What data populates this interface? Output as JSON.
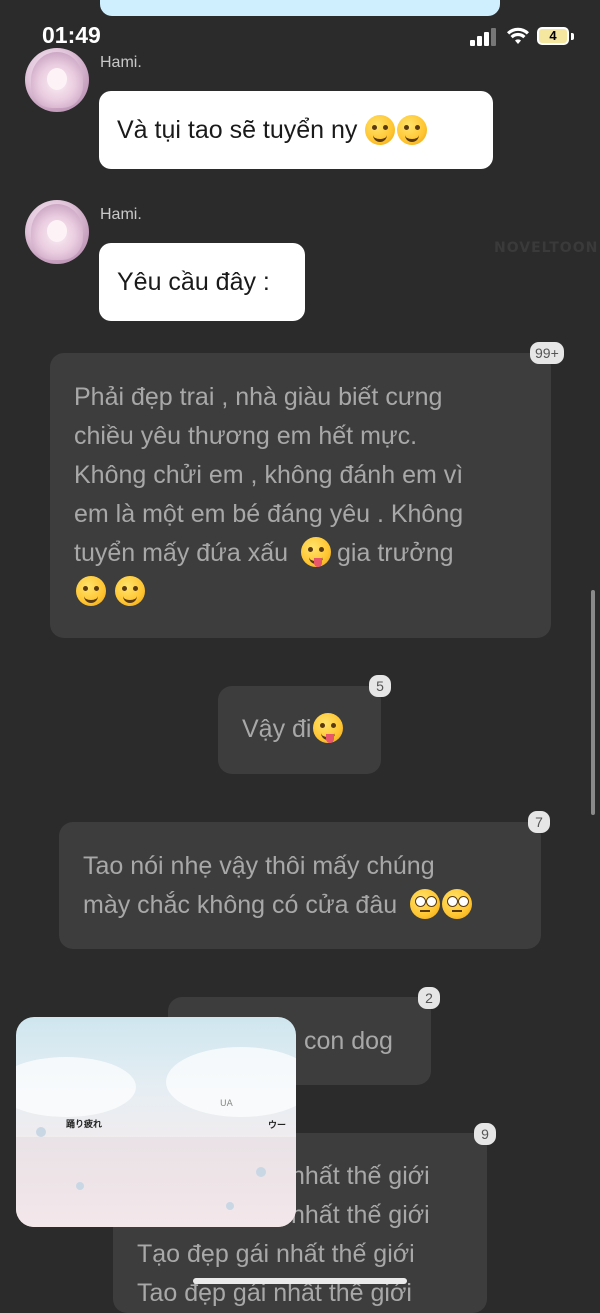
{
  "status": {
    "time": "01:49",
    "battery": "4"
  },
  "messages": [
    {
      "sender": "Hami.",
      "text": "Và tụi tao sẽ tuyển ny",
      "emoji": [
        "rolling-on-floor-laughing-icon",
        "rolling-on-floor-laughing-icon"
      ]
    },
    {
      "sender": "Hami.",
      "text": "Yêu cầu đây :"
    }
  ],
  "cards": [
    {
      "lines": [
        "Phải đẹp trai , nhà giàu biết cưng",
        "chiều yêu thương em hết mực.",
        "Không chửi em , không đánh em vì",
        "em là một em bé đáng yêu . Không",
        "tuyển mấy đứa xấu",
        "gia trưởng"
      ],
      "badge": "99+"
    },
    {
      "text": "Vậy đi",
      "badge": "5"
    },
    {
      "lines": [
        "Tao nói nhẹ vậy thôi mấy chúng",
        "mày chắc không có cửa đâu"
      ],
      "badge": "7"
    },
    {
      "text": "con dog",
      "badge": "2"
    },
    {
      "lines": [
        "nhất thế giới",
        "nhất thế giới",
        "Tạo đẹp gái nhất thế giới",
        "Tao đẹp gái nhất thế giới"
      ],
      "badge": "9"
    }
  ],
  "pip": {
    "label_left": "踊り疲れ",
    "label_right": "ウー",
    "label_top": "UA"
  },
  "watermark": "NOVELTOON"
}
